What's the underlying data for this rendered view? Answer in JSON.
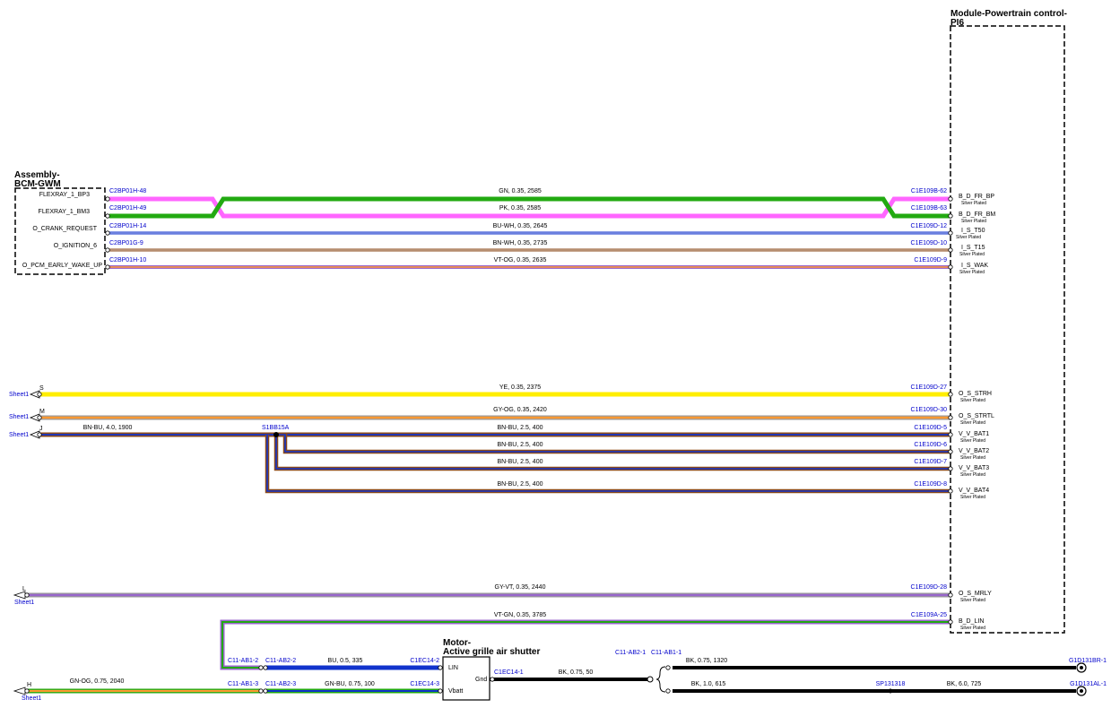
{
  "modules": {
    "pcm": {
      "title_line1": "Module-Powertrain control-",
      "title_line2": "PI6"
    },
    "bcm": {
      "title_line1": "Assembly-",
      "title_line2": "BCM-GWM"
    },
    "motor": {
      "title_line1": "Motor-",
      "title_line2": "Active grille air shutter",
      "pin_lin": "LIN",
      "pin_vbatt": "Vbatt",
      "pin_gnd": "Gnd"
    }
  },
  "bcm_signals": [
    "FLEXRAY_1_BP3",
    "FLEXRAY_1_BM3",
    "O_CRANK_REQUEST",
    "O_IGNITION_6",
    "O_PCM_EARLY_WAKE_UP"
  ],
  "pcm_pins": [
    {
      "name": "B_D_FR_BP",
      "plating": "Silver Plated"
    },
    {
      "name": "B_D_FR_BM",
      "plating": "Silver Plated"
    },
    {
      "name": "I_S_T50",
      "plating": "Silver Plated"
    },
    {
      "name": "I_S_T15",
      "plating": "Silver Plated"
    },
    {
      "name": "I_S_WAK",
      "plating": "Silver Plated"
    },
    {
      "name": "O_S_STRH",
      "plating": "Silver Plated"
    },
    {
      "name": "O_S_STRTL",
      "plating": "Silver Plated"
    },
    {
      "name": "V_V_BAT1",
      "plating": "Silver Plated"
    },
    {
      "name": "V_V_BAT2",
      "plating": "Silver Plated"
    },
    {
      "name": "V_V_BAT3",
      "plating": "Silver Plated"
    },
    {
      "name": "V_V_BAT4",
      "plating": "Silver Plated"
    },
    {
      "name": "O_S_MRLY",
      "plating": "Silver Plated"
    },
    {
      "name": "B_D_LIN",
      "plating": "Silver Plated"
    }
  ],
  "wires": [
    {
      "left": "C2BP01H-48",
      "label": "GN, 0.35, 2585",
      "right": "C1E109B-62"
    },
    {
      "left": "C2BP01H-49",
      "label": "PK, 0.35, 2585",
      "right": "C1E109B-63"
    },
    {
      "left": "C2BP01H-14",
      "label": "BU-WH, 0.35, 2645",
      "right": "C1E109D-12"
    },
    {
      "left": "C2BP01G-9",
      "label": "BN-WH, 0.35, 2735",
      "right": "C1E109D-10"
    },
    {
      "left": "C2BP01H-10",
      "label": "VT-OG, 0.35, 2635",
      "right": "C1E109D-9"
    },
    {
      "left": "S",
      "label": "YE, 0.35, 2375",
      "right": "C1E109D-27",
      "sheet": "Sheet1"
    },
    {
      "left": "M",
      "label": "GY-OG, 0.35, 2420",
      "right": "C1E109D-30",
      "sheet": "Sheet1"
    },
    {
      "left": "J",
      "label": "BN-BU, 4.0, 1900",
      "right": "",
      "sheet": "Sheet1"
    },
    {
      "left": "",
      "label": "BN-BU, 2.5, 400",
      "right": "C1E109D-5"
    },
    {
      "left": "",
      "label": "BN-BU, 2.5, 400",
      "right": "C1E109D-6"
    },
    {
      "left": "",
      "label": "BN-BU, 2.5, 400",
      "right": "C1E109D-7"
    },
    {
      "left": "",
      "label": "BN-BU, 2.5, 400",
      "right": "C1E109D-8"
    },
    {
      "left": "L",
      "label": "GY-VT, 0.35, 2440",
      "right": "C1E109D-28",
      "sheet": "Sheet1"
    },
    {
      "left": "",
      "label": "VT-GN, 0.35, 3785",
      "right": "C1E109A-25"
    }
  ],
  "splice": "S1BB15A",
  "bottom": {
    "conn_ab1_2": "C11-AB1-2",
    "conn_ab2_2": "C11-AB2-2",
    "wire_bu": "BU, 0.5, 335",
    "conn_ec14_2": "C1EC14-2",
    "conn_ab1_3": "C11-AB1-3",
    "conn_ab2_3": "C11-AB2-3",
    "wire_gnbu": "GN-BU, 0.75, 100",
    "conn_ec14_3": "C1EC14-3",
    "h_letter": "H",
    "h_sheet": "Sheet1",
    "wire_gnog": "GN-OG, 0.75, 2040",
    "conn_ec14_1": "C1EC14-1",
    "wire_bk50": "BK, 0.75, 50",
    "conn_ab2_1": "C11-AB2-1",
    "conn_ab1_1": "C11-AB1-1",
    "wire_bk1320": "BK, 0.75, 1320",
    "ground_r": "G1D131BR-1",
    "wire_bk615": "BK, 1.0, 615",
    "splice_sp": "SP131318",
    "wire_bk725": "BK, 6.0, 725",
    "ground_l": "G1D131AL-1"
  },
  "colors": {
    "gn": "#22aa11",
    "pk": "#ff66ff",
    "ye": "#ffee00",
    "og": "#ff9933",
    "bn": "#8b4a1a",
    "bu": "#1133cc",
    "vt": "#9966cc",
    "gy": "#999999",
    "bk": "#000000",
    "link_text": "#0000cc"
  }
}
